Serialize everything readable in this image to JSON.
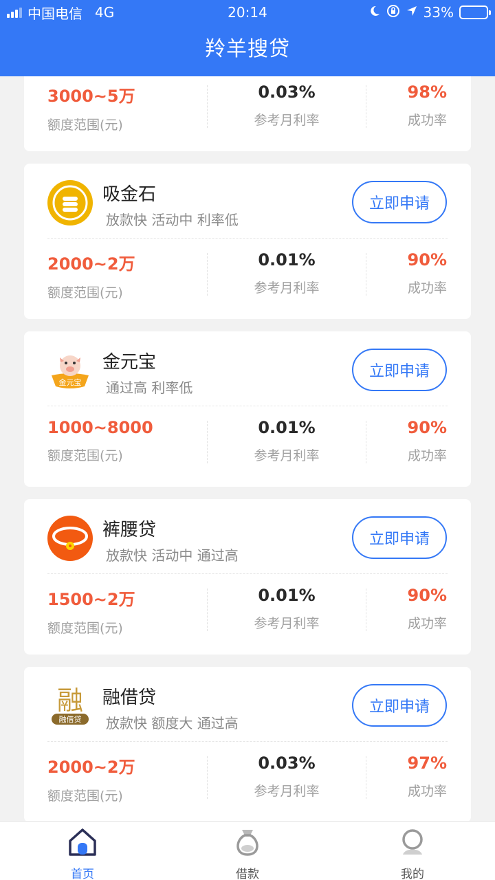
{
  "status": {
    "carrier": "中国电信",
    "network": "4G",
    "time": "20:14",
    "battery": "33%",
    "battery_level": 0.33
  },
  "header": {
    "title": "羚羊搜贷"
  },
  "actions": {
    "apply_label": "立即申请"
  },
  "stat_labels": {
    "amount": "额度范围(元)",
    "rate": "参考月利率",
    "success": "成功率"
  },
  "loans": [
    {
      "name": "",
      "tags": "",
      "amount": "3000~5万",
      "rate": "0.03%",
      "success": "98%",
      "logo": "orange-partial-icon"
    },
    {
      "name": "吸金石",
      "tags": "放款快 活动中 利率低",
      "amount": "2000~2万",
      "rate": "0.01%",
      "success": "90%",
      "logo": "gold-coin-icon"
    },
    {
      "name": "金元宝",
      "tags": "通过高 利率低",
      "amount": "1000~8000",
      "rate": "0.01%",
      "success": "90%",
      "logo": "pig-ingot-icon"
    },
    {
      "name": "裤腰贷",
      "tags": "放款快 活动中 通过高",
      "amount": "1500~2万",
      "rate": "0.01%",
      "success": "90%",
      "logo": "belt-icon"
    },
    {
      "name": "融借贷",
      "tags": "放款快 额度大 通过高",
      "amount": "2000~2万",
      "rate": "0.03%",
      "success": "97%",
      "logo": "rong-icon",
      "logo_text": "融",
      "logo_caption": "融借贷"
    }
  ],
  "tabs": [
    {
      "label": "首页",
      "icon": "home-icon",
      "active": true
    },
    {
      "label": "借款",
      "icon": "money-bag-icon",
      "active": false
    },
    {
      "label": "我的",
      "icon": "user-icon",
      "active": false
    }
  ],
  "colors": {
    "primary": "#3478f6",
    "accent": "#f05c3c",
    "gold": "#f0b400",
    "orange": "#f25a11"
  }
}
